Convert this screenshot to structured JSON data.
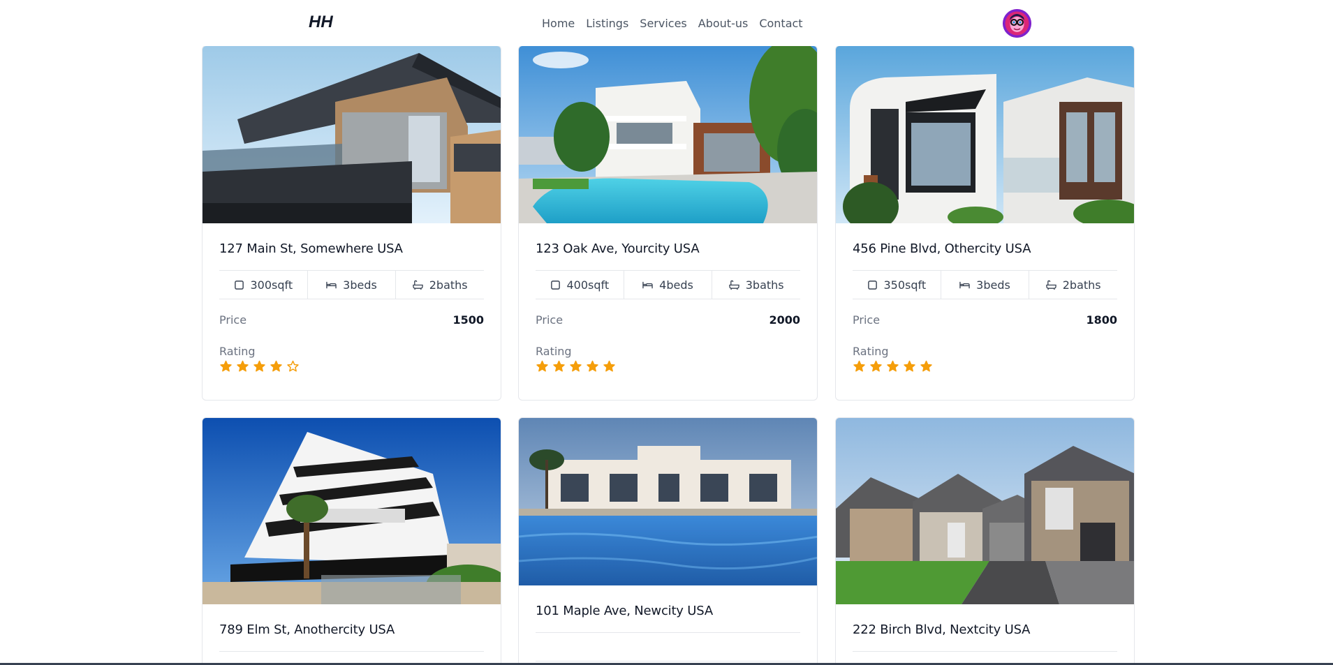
{
  "header": {
    "logo": "HH",
    "nav": [
      "Home",
      "Listings",
      "Services",
      "About-us",
      "Contact"
    ],
    "avatar_icon": "user-avatar"
  },
  "listings": [
    {
      "address": "127 Main St, Somewhere USA",
      "sqft": "300sqft",
      "beds": "3beds",
      "baths": "2baths",
      "price_label": "Price",
      "price": "1500",
      "rating_label": "Rating",
      "rating": 4,
      "rating_max": 5
    },
    {
      "address": "123 Oak Ave, Yourcity USA",
      "sqft": "400sqft",
      "beds": "4beds",
      "baths": "3baths",
      "price_label": "Price",
      "price": "2000",
      "rating_label": "Rating",
      "rating": 5,
      "rating_max": 5
    },
    {
      "address": "456 Pine Blvd, Othercity USA",
      "sqft": "350sqft",
      "beds": "3beds",
      "baths": "2baths",
      "price_label": "Price",
      "price": "1800",
      "rating_label": "Rating",
      "rating": 5,
      "rating_max": 5
    },
    {
      "address": "789 Elm St, Anothercity USA"
    },
    {
      "address": "101 Maple Ave, Newcity USA"
    },
    {
      "address": "222 Birch Blvd, Nextcity USA"
    }
  ],
  "colors": {
    "star": "#f59e0b",
    "border": "#e5e7eb",
    "muted_text": "#6b7280",
    "nav_text": "#4b5563"
  }
}
